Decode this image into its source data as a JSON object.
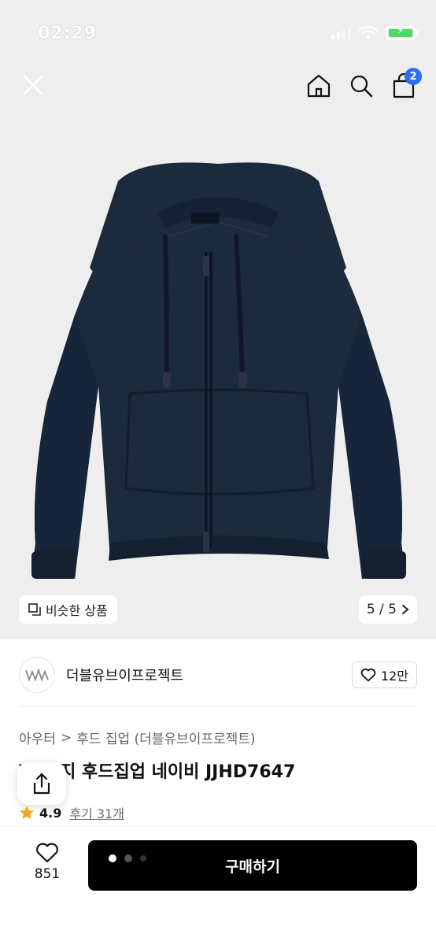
{
  "status_bar": {
    "time": "02:29"
  },
  "header": {
    "cart_count": "2"
  },
  "gallery": {
    "similar_label": "비슷한 상품",
    "pager": "5 / 5"
  },
  "brand": {
    "name": "더블유브이프로젝트",
    "likes": "12만"
  },
  "breadcrumb": {
    "category": "아우터",
    "separator": ">",
    "subcategory": "후드 집업 (더블유브이프로젝트)"
  },
  "product": {
    "title": "Ⅵ 코지 후드집업 네이비 JJHD7647",
    "rating": "4.9",
    "reviews": "후기 31개"
  },
  "bottom_bar": {
    "wish_count": "851",
    "buy_label": "구매하기"
  },
  "colors": {
    "accent": "#2f6cf0",
    "star": "#f5a623",
    "hoodie": "#1c2a3d",
    "buy_button": "#000000"
  }
}
